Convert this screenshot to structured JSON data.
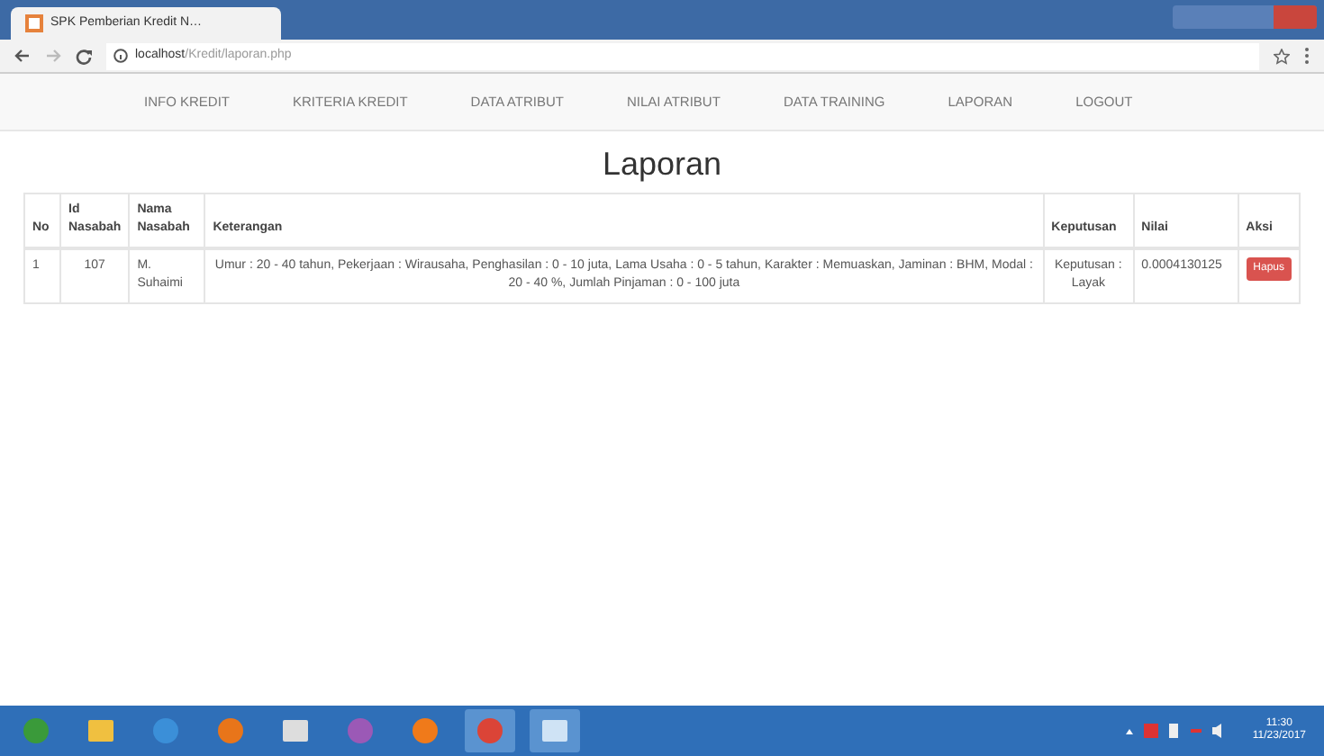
{
  "browser": {
    "tab_title": "SPK Pemberian Kredit N…",
    "url_host": "localhost",
    "url_path": "/Kredit/laporan.php"
  },
  "nav": [
    "INFO KREDIT",
    "KRITERIA KREDIT",
    "DATA ATRIBUT",
    "NILAI ATRIBUT",
    "DATA TRAINING",
    "LAPORAN",
    "LOGOUT"
  ],
  "heading": "Laporan",
  "table": {
    "columns": [
      "No",
      "Id Nasabah",
      "Nama Nasabah",
      "Keterangan",
      "Keputusan",
      "Nilai",
      "Aksi"
    ],
    "rows": [
      {
        "no": "1",
        "id": "107",
        "nama": "M. Suhaimi",
        "keterangan": "Umur : 20 - 40 tahun, Pekerjaan : Wirausaha, Penghasilan : 0 - 10 juta, Lama Usaha : 0 - 5 tahun, Karakter : Memuaskan, Jaminan : BHM, Modal : 20 - 40 %, Jumlah Pinjaman : 0 - 100 juta",
        "keputusan": "Keputusan : Layak",
        "nilai": "0.0004130125",
        "action": "Hapus"
      }
    ]
  },
  "taskbar": {
    "time": "11:30",
    "date": "11/23/2017"
  }
}
